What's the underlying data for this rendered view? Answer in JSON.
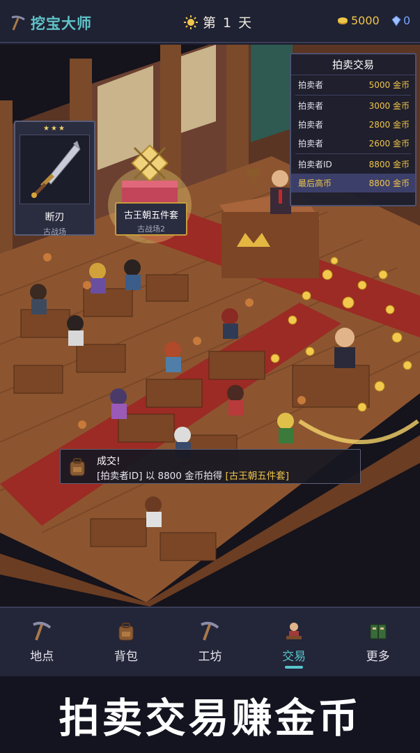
{
  "header": {
    "title": "挖宝大师",
    "day": "第 1 天",
    "coins": "5000",
    "gems": "0"
  },
  "items": {
    "left_card": {
      "stars": "★★★",
      "name": "断刃",
      "location": "古战场"
    },
    "featured": {
      "name": "古王朝五件套",
      "location": "古战场2"
    }
  },
  "auction": {
    "title": "拍卖交易",
    "rows": [
      {
        "who": "拍卖者",
        "amount": "5000 金币"
      },
      {
        "who": "拍卖者",
        "amount": "3000 金币"
      },
      {
        "who": "拍卖者",
        "amount": "2800 金币"
      },
      {
        "who": "拍卖者",
        "amount": "2600 金币"
      },
      {
        "who": "拍卖者ID",
        "amount": "8800 金币"
      },
      {
        "who": "最后高币",
        "amount": "8800 金币"
      }
    ]
  },
  "notice": {
    "title": "成交!",
    "part1": "[拍卖者ID] 以 8800 金币拍得 ",
    "item": "[古王朝五件套]"
  },
  "nav": {
    "items": [
      {
        "label": "地点",
        "icon": "pickaxe-icon"
      },
      {
        "label": "背包",
        "icon": "backpack-icon"
      },
      {
        "label": "工坊",
        "icon": "pickaxe-icon"
      },
      {
        "label": "交易",
        "icon": "merchant-icon"
      },
      {
        "label": "更多",
        "icon": "book-icon"
      }
    ],
    "active_index": 3
  },
  "slogan": "拍卖交易赚金币",
  "colors": {
    "accent": "#56c6cc",
    "gold": "#f0c64a",
    "gem": "#7aa3ff"
  }
}
